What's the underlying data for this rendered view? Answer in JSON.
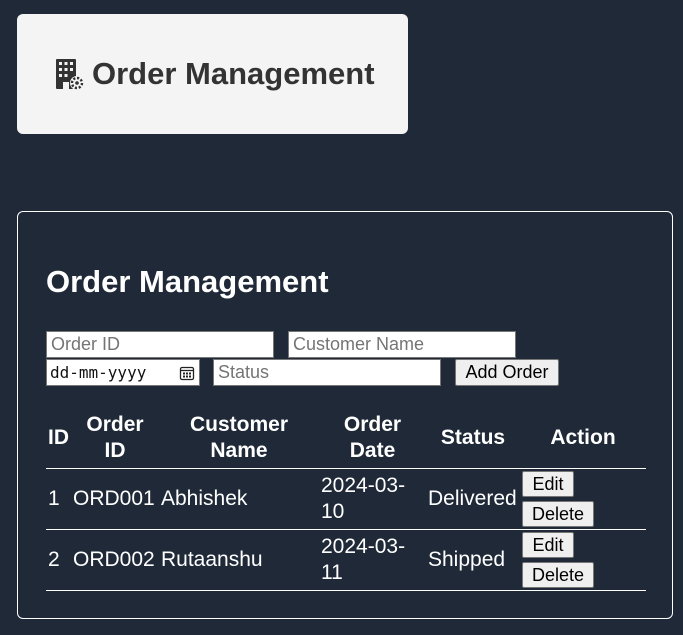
{
  "header": {
    "title": "Order Management",
    "icon": "building-gear-icon"
  },
  "panel": {
    "title": "Order Management"
  },
  "form": {
    "order_id_placeholder": "Order ID",
    "customer_name_placeholder": "Customer Name",
    "date_placeholder": "dd-mm-yyyy",
    "status_placeholder": "Status",
    "add_button": "Add Order"
  },
  "table": {
    "headers": [
      "ID",
      "Order ID",
      "Customer Name",
      "Order Date",
      "Status",
      "Action"
    ],
    "rows": [
      {
        "id": "1",
        "order_id": "ORD001",
        "customer": "Abhishek",
        "date": "2024-03-10",
        "status": "Delivered",
        "edit": "Edit",
        "delete": "Delete"
      },
      {
        "id": "2",
        "order_id": "ORD002",
        "customer": "Rutaanshu",
        "date": "2024-03-11",
        "status": "Shipped",
        "edit": "Edit",
        "delete": "Delete"
      }
    ]
  },
  "colors": {
    "background": "#1f2937",
    "header_card": "#f4f4f4",
    "header_text": "#333333"
  }
}
